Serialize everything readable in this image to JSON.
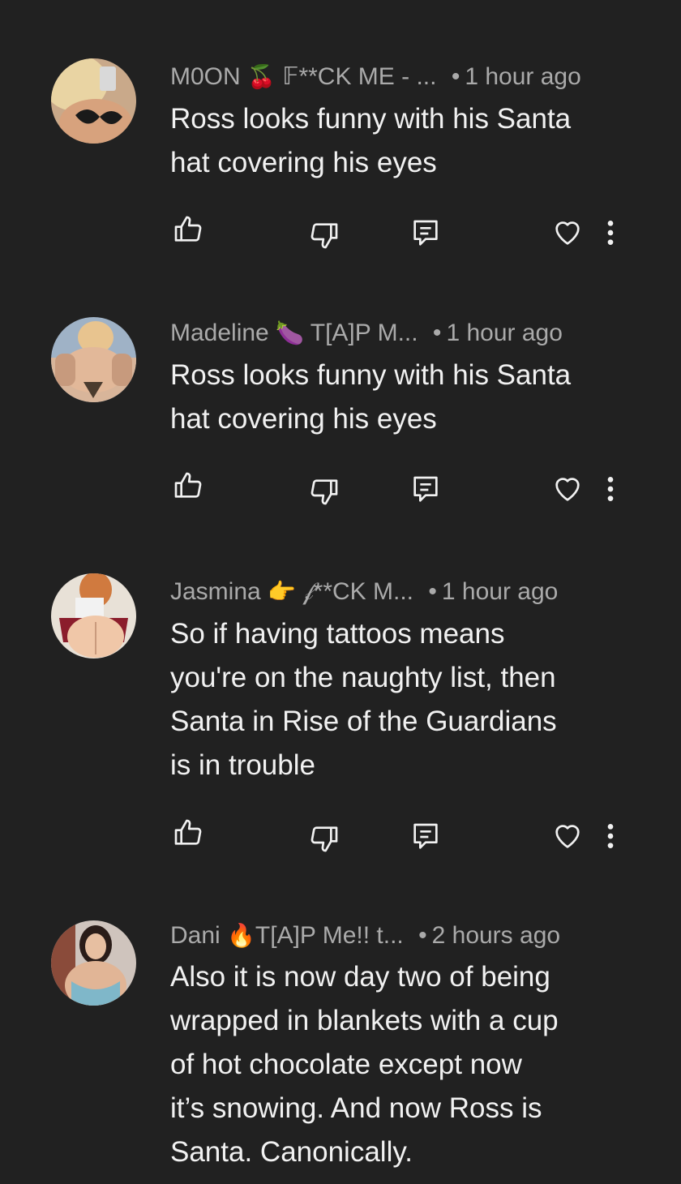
{
  "comments": [
    {
      "author": "M0ON",
      "author_emoji": "🍒",
      "author_suffix": "𝔽**CK ME - ...",
      "time": "1 hour ago",
      "text_lines": [
        "Ross looks funny with his Santa",
        "hat covering his eyes"
      ]
    },
    {
      "author": "Madeline",
      "author_emoji": "🍆",
      "author_suffix": "T[A]P M...",
      "time": "1 hour ago",
      "text_lines": [
        "Ross looks funny with his Santa",
        "hat covering his eyes"
      ]
    },
    {
      "author": "Jasmina",
      "author_emoji": "👉",
      "author_suffix": "𝒻**CK M...",
      "time": "1 hour ago",
      "text_lines": [
        "So if having tattoos means",
        "you're on the naughty list, then",
        "Santa in Rise of the Guardians",
        "is in trouble"
      ]
    },
    {
      "author": "Dani",
      "author_emoji": "🔥",
      "author_suffix": "T[A]P Me!! t...",
      "time": "2 hours ago",
      "text_lines": [
        "Also it is now day two of being",
        "wrapped in blankets with a cup",
        "of hot chocolate except now",
        "it’s snowing. And now Ross is",
        "Santa. Canonically."
      ]
    }
  ],
  "meta_separator": "•",
  "icons": {
    "like": "thumbs-up-icon",
    "dislike": "thumbs-down-icon",
    "reply": "reply-icon",
    "heart": "heart-icon",
    "more": "more-vert-icon"
  },
  "colors": {
    "background": "#212121",
    "text": "#f1f1f1",
    "meta": "#aaaaaa"
  }
}
